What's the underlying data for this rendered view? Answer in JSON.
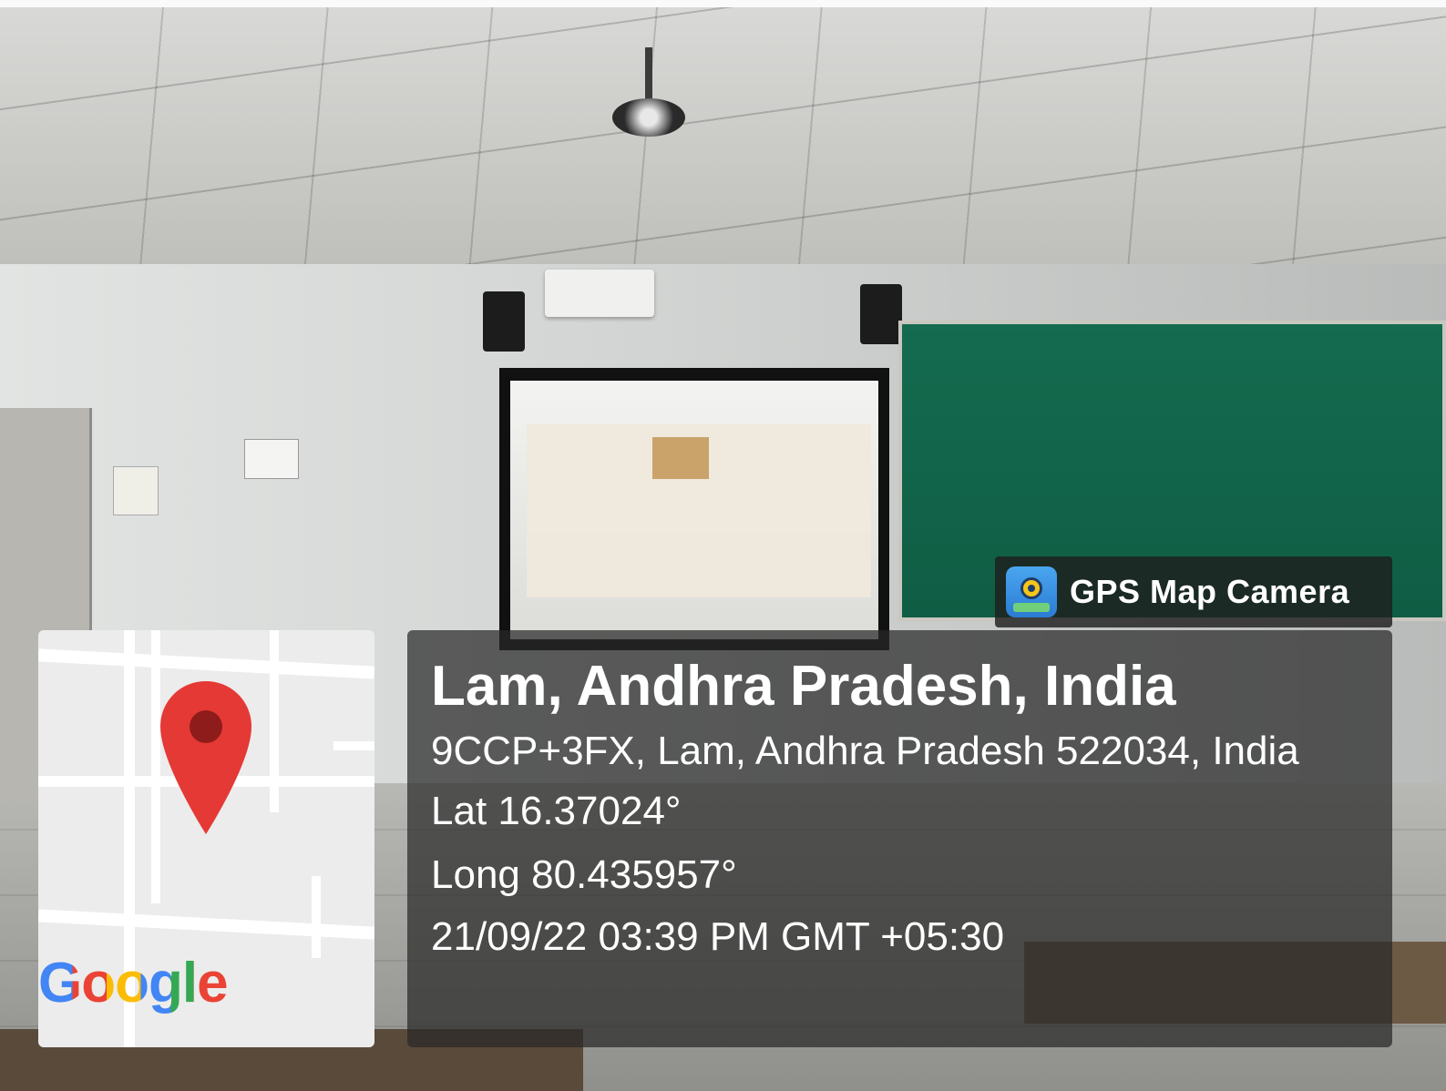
{
  "watermark": {
    "app_name": "GPS Map Camera",
    "icon": "gps-map-camera-icon"
  },
  "location": {
    "title": "Lam, Andhra Pradesh, India",
    "address": "9CCP+3FX, Lam, Andhra Pradesh 522034, India",
    "latitude": "Lat 16.37024°",
    "longitude": "Long 80.435957°",
    "datetime": "21/09/22 03:39 PM GMT +05:30"
  },
  "map": {
    "logo": "Google",
    "pin_icon": "map-pin-icon",
    "pin_color": "#e53935",
    "logo_colors": [
      "#4285f4",
      "#ea4335",
      "#fbbc05",
      "#4285f4",
      "#34a853",
      "#ea4335"
    ]
  }
}
